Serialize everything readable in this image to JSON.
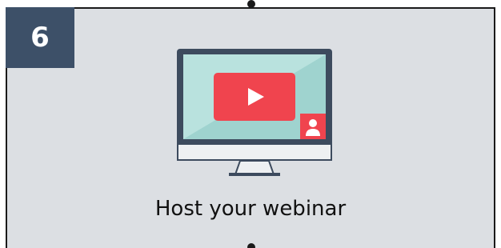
{
  "step": {
    "number": "6"
  },
  "caption": {
    "text": "Host your webinar"
  },
  "colors": {
    "badge_bg": "#3d5068",
    "card_bg": "#dcdfe3",
    "screen_bg": "#9fd3cf",
    "video_red": "#f0444e",
    "monitor_frame": "#3d4b5e"
  },
  "icons": {
    "illustration": "desktop-monitor-video-icon",
    "play": "play-icon",
    "presenter": "user-icon"
  }
}
